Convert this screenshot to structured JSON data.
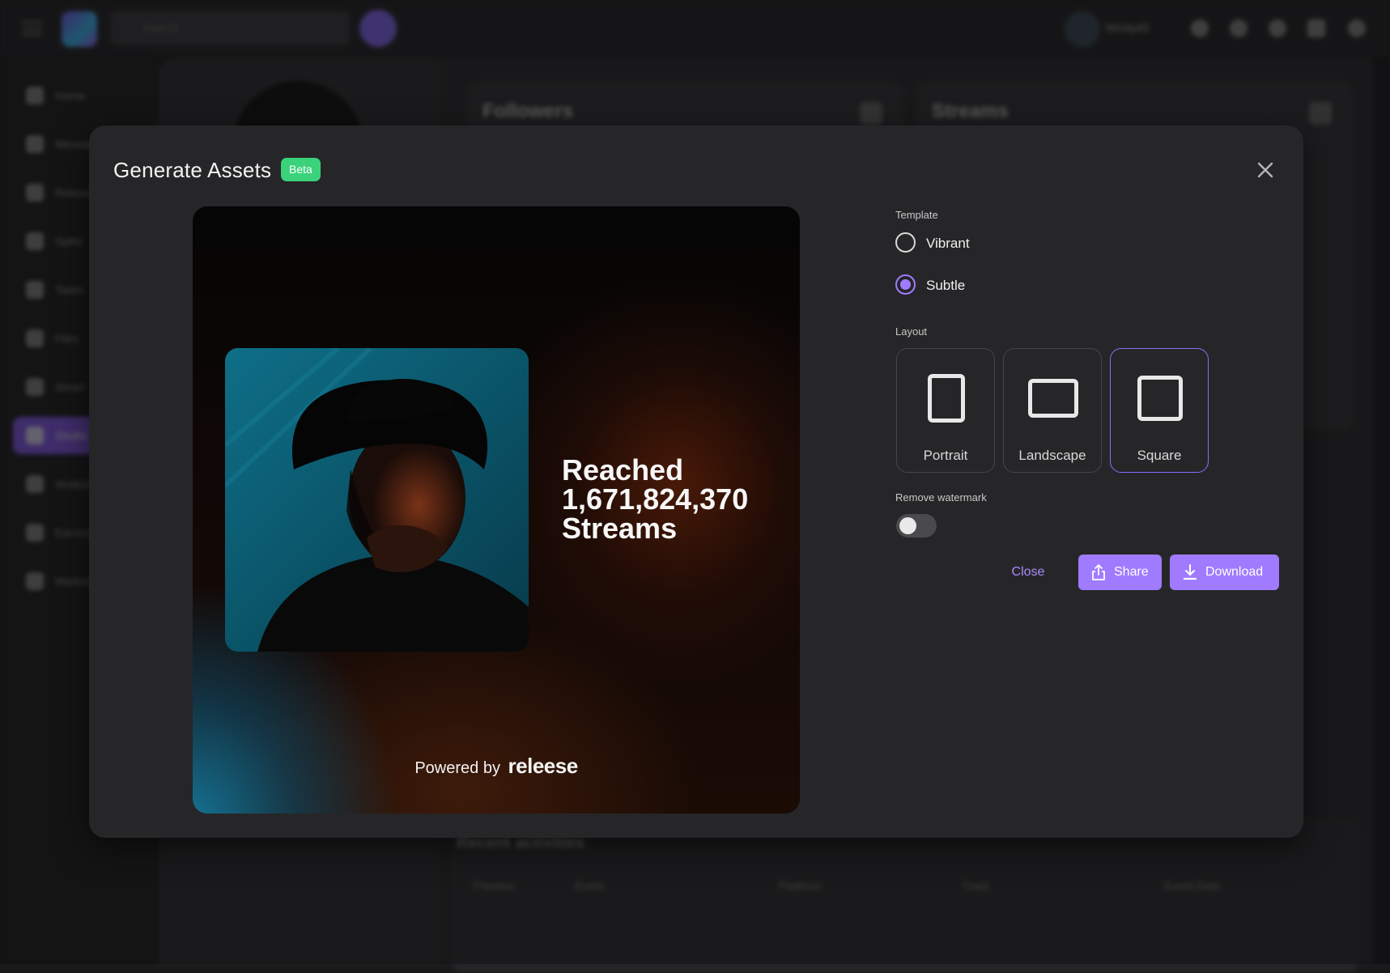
{
  "app": {
    "search_placeholder": "Search",
    "user_name": "Wristyd3",
    "sidebar": [
      {
        "label": "Home"
      },
      {
        "label": "Messages"
      },
      {
        "label": "Releases"
      },
      {
        "label": "Splits"
      },
      {
        "label": "Tasks"
      },
      {
        "label": "Files"
      },
      {
        "label": "Smart"
      },
      {
        "label": "Studio"
      },
      {
        "label": "Analytics"
      },
      {
        "label": "Earnings"
      },
      {
        "label": "Marketing"
      }
    ],
    "cards": {
      "followers_title": "Followers",
      "streams_title": "Streams"
    },
    "recent": {
      "title": "Recent activities",
      "columns": [
        "Preview",
        "Event",
        "Platform",
        "Track",
        "Event Date"
      ]
    }
  },
  "modal": {
    "title": "Generate Assets",
    "badge": "Beta",
    "preview": {
      "line1": "Reached",
      "line2": "1,671,824,370",
      "line3": "Streams",
      "powered_prefix": "Powered by",
      "powered_brand": "releese"
    },
    "template": {
      "label": "Template",
      "options": [
        {
          "label": "Vibrant",
          "checked": false
        },
        {
          "label": "Subtle",
          "checked": true
        }
      ]
    },
    "layout": {
      "label": "Layout",
      "options": [
        {
          "label": "Portrait",
          "selected": false
        },
        {
          "label": "Landscape",
          "selected": false
        },
        {
          "label": "Square",
          "selected": true
        }
      ]
    },
    "watermark": {
      "label": "Remove watermark",
      "enabled": false
    },
    "actions": {
      "close": "Close",
      "share": "Share",
      "download": "Download"
    }
  },
  "colors": {
    "accent": "#a07bff",
    "beta": "#3ad27a",
    "modal_bg": "#262628"
  }
}
